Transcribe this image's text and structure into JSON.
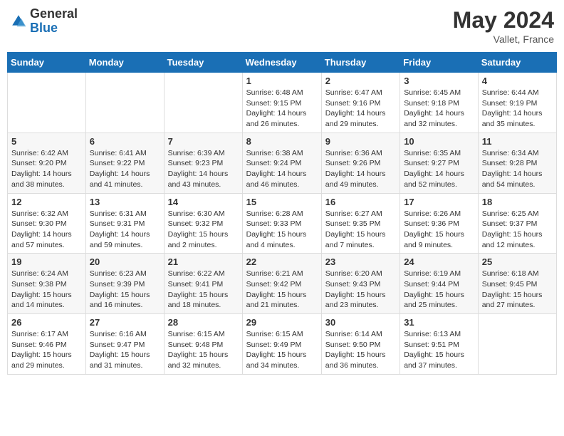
{
  "logo": {
    "general": "General",
    "blue": "Blue"
  },
  "header": {
    "month": "May 2024",
    "location": "Vallet, France"
  },
  "weekdays": [
    "Sunday",
    "Monday",
    "Tuesday",
    "Wednesday",
    "Thursday",
    "Friday",
    "Saturday"
  ],
  "weeks": [
    [
      {
        "day": "",
        "content": ""
      },
      {
        "day": "",
        "content": ""
      },
      {
        "day": "",
        "content": ""
      },
      {
        "day": "1",
        "content": "Sunrise: 6:48 AM\nSunset: 9:15 PM\nDaylight: 14 hours\nand 26 minutes."
      },
      {
        "day": "2",
        "content": "Sunrise: 6:47 AM\nSunset: 9:16 PM\nDaylight: 14 hours\nand 29 minutes."
      },
      {
        "day": "3",
        "content": "Sunrise: 6:45 AM\nSunset: 9:18 PM\nDaylight: 14 hours\nand 32 minutes."
      },
      {
        "day": "4",
        "content": "Sunrise: 6:44 AM\nSunset: 9:19 PM\nDaylight: 14 hours\nand 35 minutes."
      }
    ],
    [
      {
        "day": "5",
        "content": "Sunrise: 6:42 AM\nSunset: 9:20 PM\nDaylight: 14 hours\nand 38 minutes."
      },
      {
        "day": "6",
        "content": "Sunrise: 6:41 AM\nSunset: 9:22 PM\nDaylight: 14 hours\nand 41 minutes."
      },
      {
        "day": "7",
        "content": "Sunrise: 6:39 AM\nSunset: 9:23 PM\nDaylight: 14 hours\nand 43 minutes."
      },
      {
        "day": "8",
        "content": "Sunrise: 6:38 AM\nSunset: 9:24 PM\nDaylight: 14 hours\nand 46 minutes."
      },
      {
        "day": "9",
        "content": "Sunrise: 6:36 AM\nSunset: 9:26 PM\nDaylight: 14 hours\nand 49 minutes."
      },
      {
        "day": "10",
        "content": "Sunrise: 6:35 AM\nSunset: 9:27 PM\nDaylight: 14 hours\nand 52 minutes."
      },
      {
        "day": "11",
        "content": "Sunrise: 6:34 AM\nSunset: 9:28 PM\nDaylight: 14 hours\nand 54 minutes."
      }
    ],
    [
      {
        "day": "12",
        "content": "Sunrise: 6:32 AM\nSunset: 9:30 PM\nDaylight: 14 hours\nand 57 minutes."
      },
      {
        "day": "13",
        "content": "Sunrise: 6:31 AM\nSunset: 9:31 PM\nDaylight: 14 hours\nand 59 minutes."
      },
      {
        "day": "14",
        "content": "Sunrise: 6:30 AM\nSunset: 9:32 PM\nDaylight: 15 hours\nand 2 minutes."
      },
      {
        "day": "15",
        "content": "Sunrise: 6:28 AM\nSunset: 9:33 PM\nDaylight: 15 hours\nand 4 minutes."
      },
      {
        "day": "16",
        "content": "Sunrise: 6:27 AM\nSunset: 9:35 PM\nDaylight: 15 hours\nand 7 minutes."
      },
      {
        "day": "17",
        "content": "Sunrise: 6:26 AM\nSunset: 9:36 PM\nDaylight: 15 hours\nand 9 minutes."
      },
      {
        "day": "18",
        "content": "Sunrise: 6:25 AM\nSunset: 9:37 PM\nDaylight: 15 hours\nand 12 minutes."
      }
    ],
    [
      {
        "day": "19",
        "content": "Sunrise: 6:24 AM\nSunset: 9:38 PM\nDaylight: 15 hours\nand 14 minutes."
      },
      {
        "day": "20",
        "content": "Sunrise: 6:23 AM\nSunset: 9:39 PM\nDaylight: 15 hours\nand 16 minutes."
      },
      {
        "day": "21",
        "content": "Sunrise: 6:22 AM\nSunset: 9:41 PM\nDaylight: 15 hours\nand 18 minutes."
      },
      {
        "day": "22",
        "content": "Sunrise: 6:21 AM\nSunset: 9:42 PM\nDaylight: 15 hours\nand 21 minutes."
      },
      {
        "day": "23",
        "content": "Sunrise: 6:20 AM\nSunset: 9:43 PM\nDaylight: 15 hours\nand 23 minutes."
      },
      {
        "day": "24",
        "content": "Sunrise: 6:19 AM\nSunset: 9:44 PM\nDaylight: 15 hours\nand 25 minutes."
      },
      {
        "day": "25",
        "content": "Sunrise: 6:18 AM\nSunset: 9:45 PM\nDaylight: 15 hours\nand 27 minutes."
      }
    ],
    [
      {
        "day": "26",
        "content": "Sunrise: 6:17 AM\nSunset: 9:46 PM\nDaylight: 15 hours\nand 29 minutes."
      },
      {
        "day": "27",
        "content": "Sunrise: 6:16 AM\nSunset: 9:47 PM\nDaylight: 15 hours\nand 31 minutes."
      },
      {
        "day": "28",
        "content": "Sunrise: 6:15 AM\nSunset: 9:48 PM\nDaylight: 15 hours\nand 32 minutes."
      },
      {
        "day": "29",
        "content": "Sunrise: 6:15 AM\nSunset: 9:49 PM\nDaylight: 15 hours\nand 34 minutes."
      },
      {
        "day": "30",
        "content": "Sunrise: 6:14 AM\nSunset: 9:50 PM\nDaylight: 15 hours\nand 36 minutes."
      },
      {
        "day": "31",
        "content": "Sunrise: 6:13 AM\nSunset: 9:51 PM\nDaylight: 15 hours\nand 37 minutes."
      },
      {
        "day": "",
        "content": ""
      }
    ]
  ]
}
